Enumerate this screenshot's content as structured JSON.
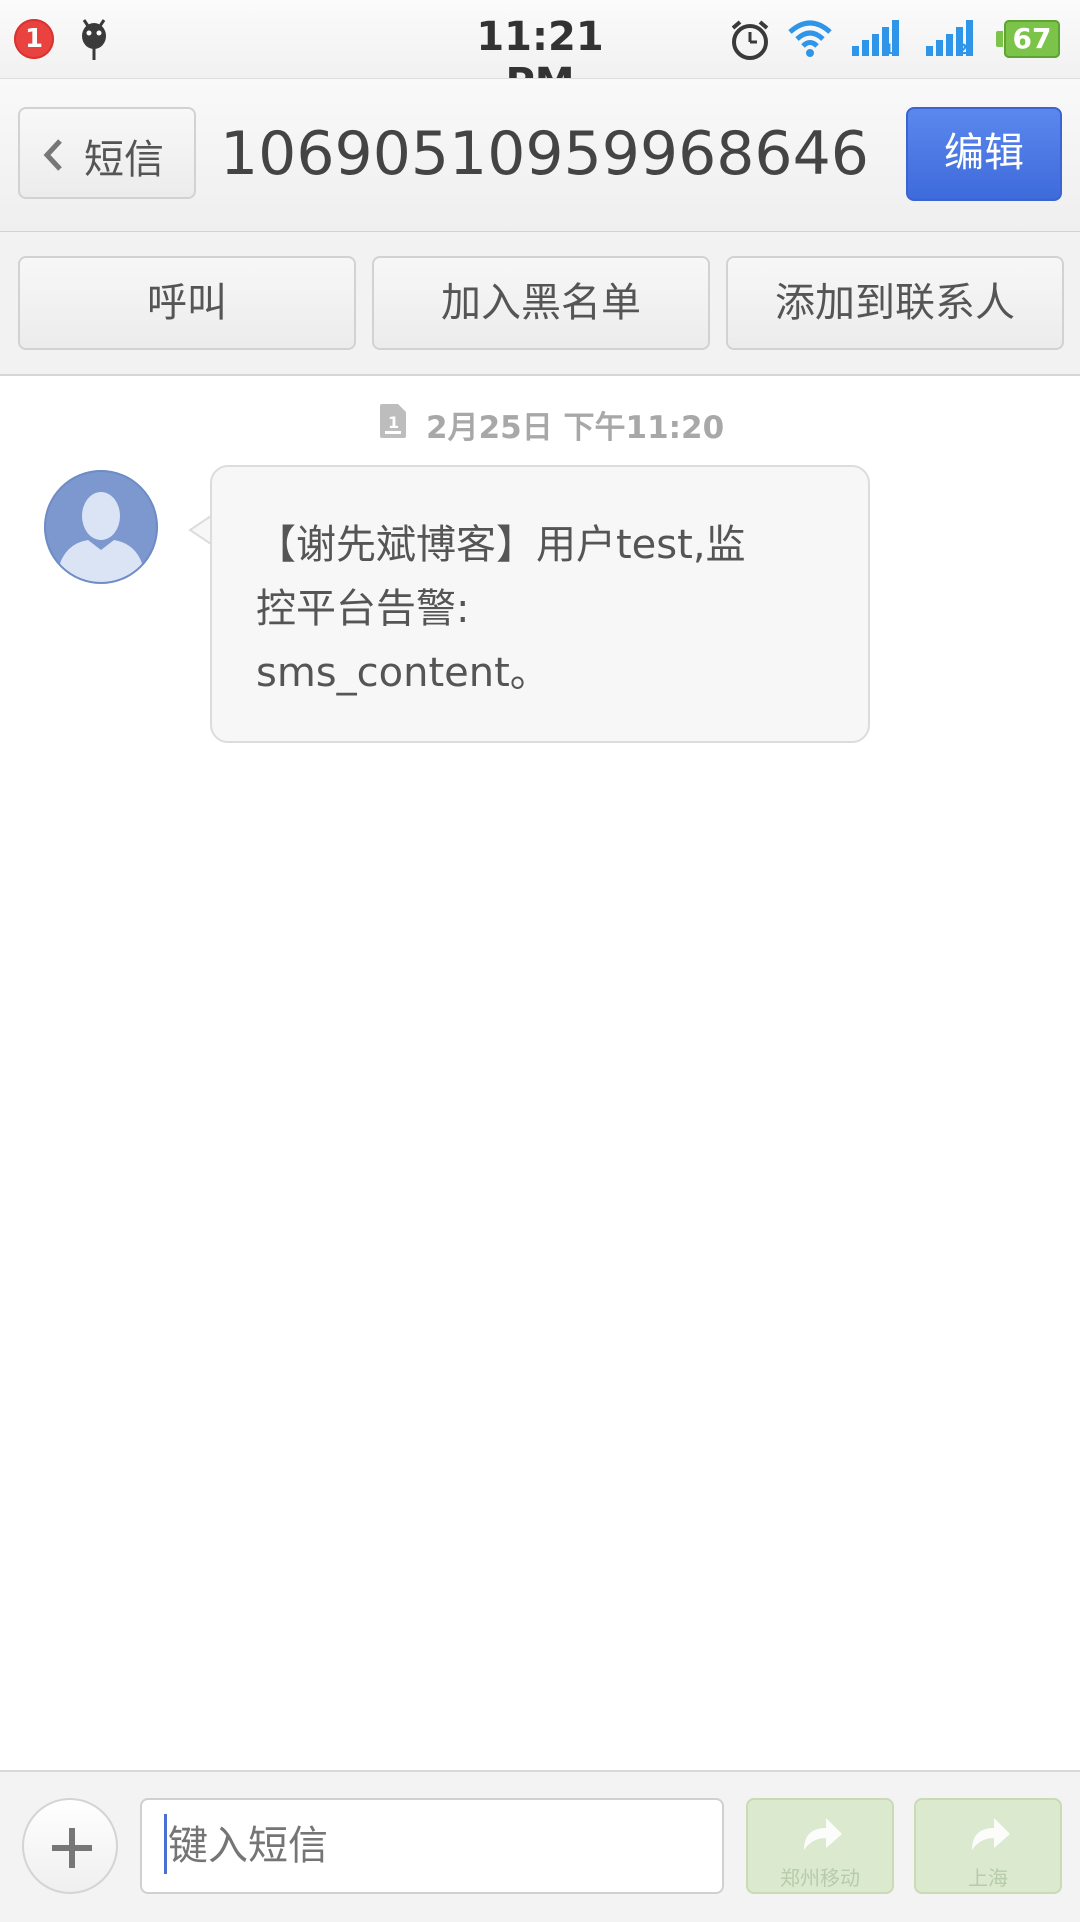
{
  "status_bar": {
    "notification_count": "1",
    "time": "11:21 PM",
    "battery": "67",
    "colors": {
      "badge": "#e9423f",
      "battery": "#7cc34a",
      "wifi": "#2f95e9",
      "signal": "#2f95e9"
    },
    "icons": [
      "notification-badge",
      "debug-bug-icon",
      "alarm-icon",
      "wifi-icon",
      "signal-sim1-icon",
      "signal-sim2-icon",
      "battery-icon"
    ]
  },
  "header": {
    "back_label": "短信",
    "title": "10690510959968646",
    "edit_label": "编辑",
    "accent": "#4a78e3"
  },
  "actions": {
    "call": "呼叫",
    "blacklist": "加入黑名单",
    "add_contact": "添加到联系人"
  },
  "conversation": {
    "timestamp": "2月25日 下午11:20",
    "sim_slot": "1",
    "message": "【谢先斌博客】用户test,监\n控平台告警:\nsms_content。"
  },
  "compose": {
    "placeholder": "键入短信",
    "send_sim1_label": "郑州移动",
    "send_sim2_label": "上海"
  }
}
